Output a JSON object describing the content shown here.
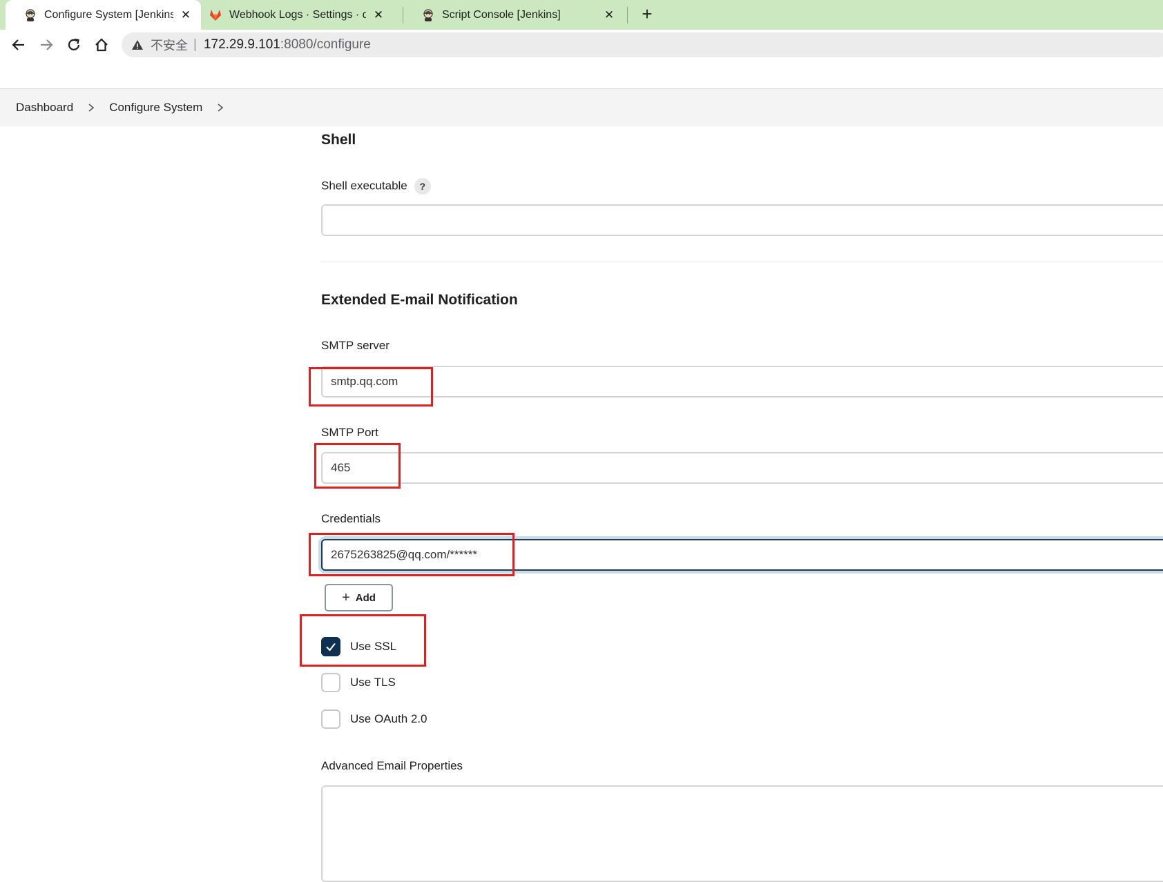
{
  "browser": {
    "tabs": [
      {
        "title": "Configure System [Jenkins]",
        "active": true,
        "icon": "jenkins-icon"
      },
      {
        "title": "Webhook Logs · Settings · dev",
        "active": false,
        "icon": "gitlab-icon"
      },
      {
        "title": "Script Console [Jenkins]",
        "active": false,
        "icon": "jenkins-icon"
      }
    ],
    "close_glyph": "✕",
    "newtab_glyph": "+",
    "address": {
      "insecure_label": "不安全",
      "separator": "|",
      "host": "172.29.9.101",
      "path": ":8080/configure"
    }
  },
  "breadcrumb": {
    "items": [
      "Dashboard",
      "Configure System"
    ]
  },
  "shell": {
    "heading": "Shell",
    "executable_label": "Shell executable",
    "help_glyph": "?",
    "executable_value": ""
  },
  "email": {
    "heading": "Extended E-mail Notification",
    "smtp_server_label": "SMTP server",
    "smtp_server_value": "smtp.qq.com",
    "smtp_port_label": "SMTP Port",
    "smtp_port_value": "465",
    "credentials_label": "Credentials",
    "credentials_value": "2675263825@qq.com/******",
    "add_label": "Add",
    "add_glyph": "+",
    "use_ssl_label": "Use SSL",
    "use_ssl_checked": true,
    "use_tls_label": "Use TLS",
    "use_tls_checked": false,
    "use_oauth_label": "Use OAuth 2.0",
    "use_oauth_checked": false,
    "advanced_label": "Advanced Email Properties"
  },
  "colors": {
    "tabstrip": "#cbe8c0",
    "checkbox_checked": "#0e3152",
    "annotation_red": "#e0201f"
  }
}
